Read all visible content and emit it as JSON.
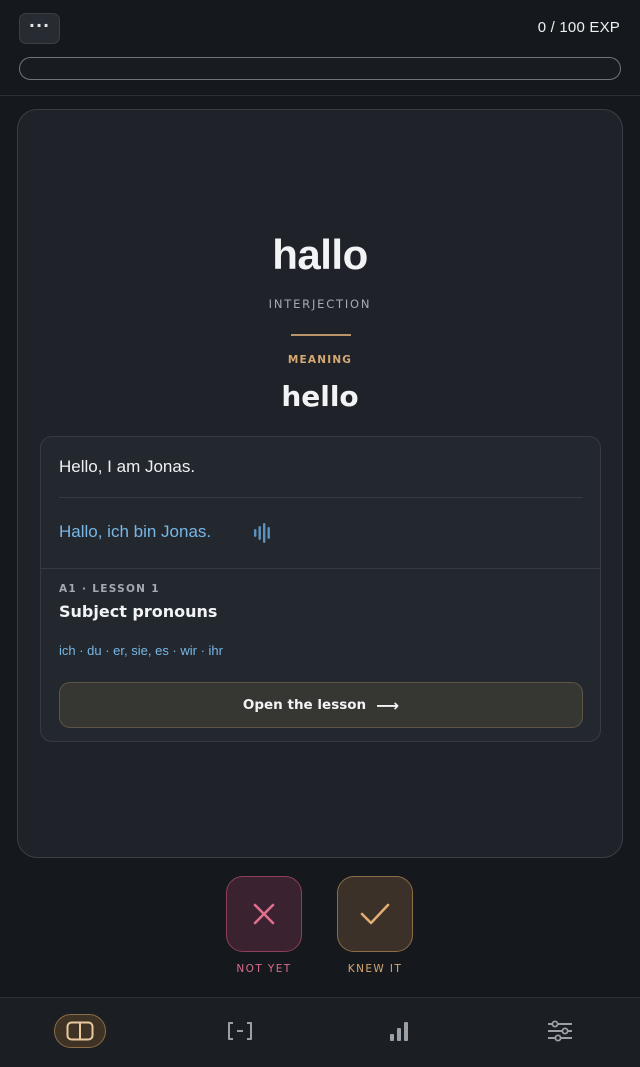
{
  "header": {
    "menu_label": "···",
    "exp_text": "0 / 100 EXP",
    "progress_fraction": 0
  },
  "card": {
    "word": "hallo",
    "part_of_speech": "INTERJECTION",
    "meaning_label": "MEANING",
    "meaning": "hello",
    "example": {
      "english": "Hello, I am Jonas.",
      "german": "Hallo, ich bin Jonas."
    },
    "lesson": {
      "meta": "A1 · LESSON 1",
      "title": "Subject pronouns",
      "words": "ich · du · er, sie, es · wir · ihr",
      "open_label": "Open the lesson",
      "open_arrow": "⟶"
    }
  },
  "answers": {
    "no_label": "NOT YET",
    "yes_label": "KNEW IT"
  },
  "nav": {
    "items": [
      {
        "icon": "book-icon",
        "active": true
      },
      {
        "icon": "bracket-icon",
        "active": false
      },
      {
        "icon": "bar-chart-icon",
        "active": false
      },
      {
        "icon": "sliders-icon",
        "active": false
      }
    ]
  },
  "colors": {
    "background": "#15181c",
    "card": "#1f2329",
    "accent_gold": "#d6a873",
    "accent_blue": "#78b6e6",
    "accent_pink": "#d86e8d"
  }
}
